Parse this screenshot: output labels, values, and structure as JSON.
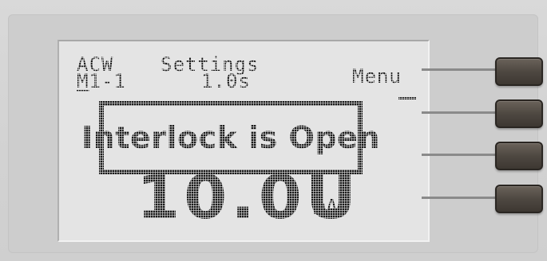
{
  "display": {
    "mode": "ACW",
    "memory_prefix": "M",
    "memory_rest": "1-1",
    "settings_label": "Settings",
    "time": "1.0s",
    "menu_label": "Menu",
    "alert_message": "Interlock is Open",
    "reading": "10.0U",
    "unit": "mA"
  },
  "softkeys": {
    "count": 4
  }
}
